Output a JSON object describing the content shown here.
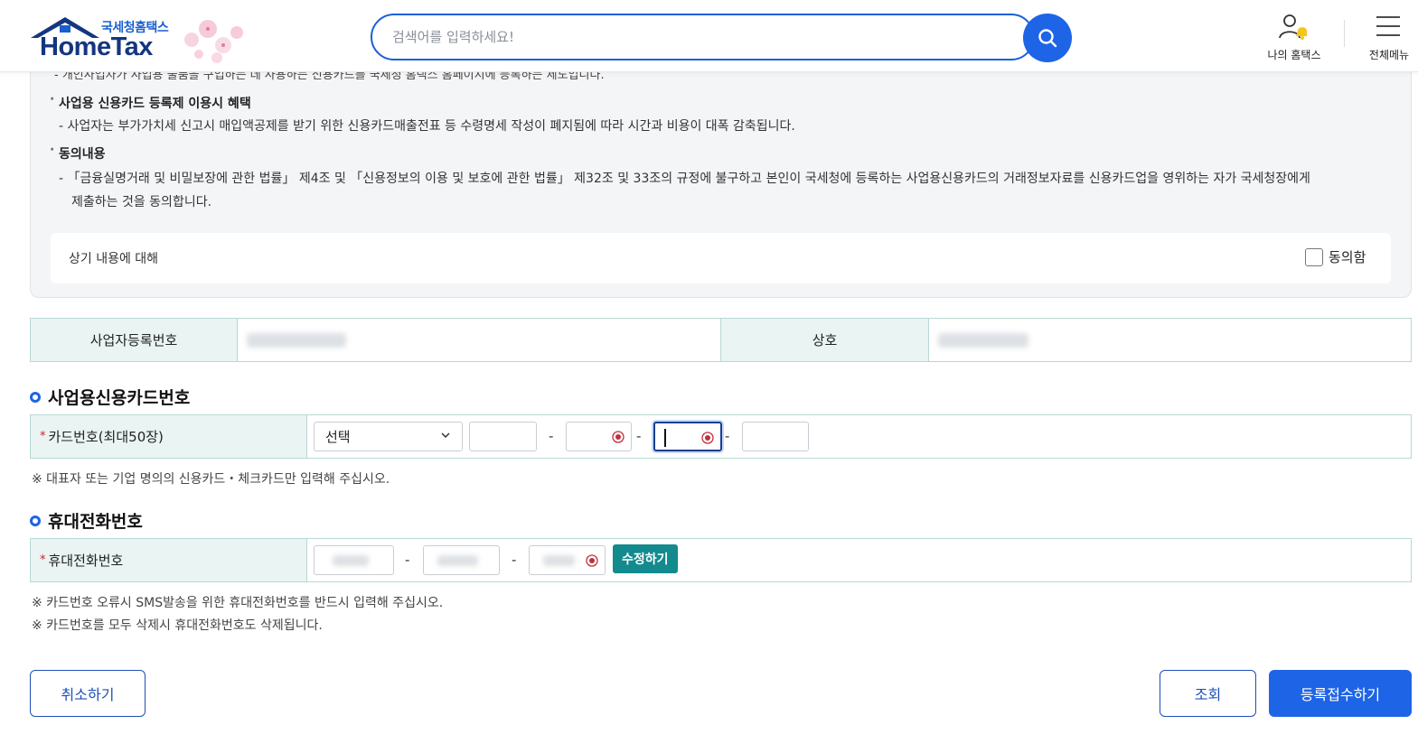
{
  "header": {
    "logo_sub": "국세청홈택스",
    "logo_main": "HomeTax",
    "search_placeholder": "검색어를 입력하세요!",
    "my_hometax": "나의 홈택스",
    "all_menu": "전체메뉴"
  },
  "agreement": {
    "cut_line": "- 개인사업자가 사업용 물품을 구입하는 데 사용하는 신용카드를 국세청 홈택스 홈페이지에 등록하는 제도입니다.",
    "benefit_title": "사업용 신용카드 등록제 이용시 혜택",
    "benefit_text": "- 사업자는 부가가치세 신고시 매입액공제를 받기 위한 신용카드매출전표 등 수령명세 작성이 폐지됨에 따라 시간과 비용이 대폭 감축됩니다.",
    "consent_title": "동의내용",
    "consent_text_1": "- 「금융실명거래 및 비밀보장에 관한 법률」 제4조 및 「신용정보의 이용 및 보호에 관한 법률」 제32조 및 33조의 규정에 불구하고 본인이 국세청에 등록하는 사업용신용카드의   거래정보자료를 신용카드업을 영위하는 자가 국세청장에게",
    "consent_text_2": "제출하는 것을 동의합니다.",
    "question": "상기 내용에 대해",
    "agree_label": "동의함"
  },
  "business": {
    "reg_no_label": "사업자등록번호",
    "name_label": "상호"
  },
  "card_section": {
    "title": "사업용신용카드번호",
    "row_label": "카드번호(최대50장)",
    "select_value": "선택",
    "note": "※ 대표자 또는 기업 명의의 신용카드・체크카드만 입력해 주십시오."
  },
  "phone_section": {
    "title": "휴대전화번호",
    "row_label": "휴대전화번호",
    "edit_button": "수정하기",
    "note_1": "※ 카드번호 오류시 SMS발송을 위한 휴대전화번호를 반드시 입력해 주십시오.",
    "note_2": "※ 카드번호를 모두 삭제시 휴대전화번호도 삭제됩니다."
  },
  "actions": {
    "cancel": "취소하기",
    "search": "조회",
    "submit": "등록접수하기"
  },
  "colors": {
    "accent": "#1e64e6",
    "teal": "#128a8e",
    "table_header": "#e9f4f3",
    "required": "#d0202e"
  }
}
